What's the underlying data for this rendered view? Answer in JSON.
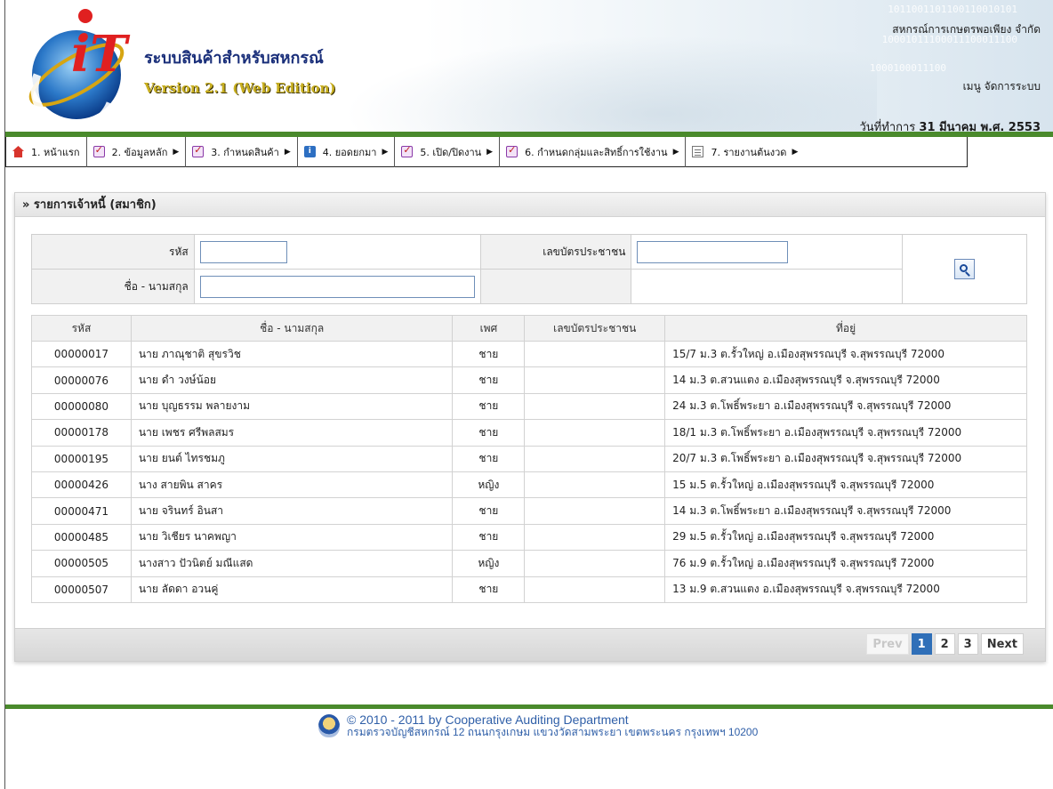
{
  "header": {
    "title": "ระบบสินค้าสำหรับสหกรณ์",
    "version": "Version 2.1 (Web Edition)",
    "org_name": "สหกรณ์การเกษตรพอเพียง จำกัด",
    "user_menu": "เมนู จัดการระบบ",
    "work_date_label": "วันที่ทำการ",
    "work_date_value": "31 มีนาคม พ.ศ. 2553",
    "logo_text": "iT",
    "logo_ring_text": "Full Pack Accounting Software · FAS",
    "binary_1": "1011001101100110010101",
    "binary_2": "10001011100011100011100",
    "binary_3": "1000100011100"
  },
  "menu": [
    {
      "label": "1. หน้าแรก",
      "icon": "home-icon",
      "arrow": false
    },
    {
      "label": "2. ข้อมูลหลัก",
      "icon": "checklist-icon",
      "arrow": true
    },
    {
      "label": "3. กำหนดสินค้า",
      "icon": "checklist-icon",
      "arrow": true
    },
    {
      "label": "4. ยอดยกมา",
      "icon": "info-icon",
      "arrow": true
    },
    {
      "label": "5. เปิด/ปิดงาน",
      "icon": "checklist-icon",
      "arrow": true
    },
    {
      "label": "6. กำหนดกลุ่มและสิทธิ์การใช้งาน",
      "icon": "checklist-icon",
      "arrow": true
    },
    {
      "label": "7. รายงานต้นงวด",
      "icon": "document-icon",
      "arrow": true
    }
  ],
  "panel": {
    "title": "» รายการเจ้าหนี้ (สมาชิก)"
  },
  "search": {
    "code_label": "รหัส",
    "code_value": "",
    "id_card_label": "เลขบัตรประชาชน",
    "id_card_value": "",
    "name_label": "ชื่อ - นามสกุล",
    "name_value": ""
  },
  "table": {
    "columns": [
      "รหัส",
      "ชื่อ - นามสกุล",
      "เพศ",
      "เลขบัตรประชาชน",
      "ที่อยู่"
    ],
    "rows": [
      {
        "code": "00000017",
        "name": "นาย ภาณุชาติ สุขรวิช",
        "sex": "ชาย",
        "id_card": "",
        "address": "15/7 ม.3 ต.รั้วใหญ่ อ.เมืองสุพรรณบุรี จ.สุพรรณบุรี 72000"
      },
      {
        "code": "00000076",
        "name": "นาย ดำ วงษ์น้อย",
        "sex": "ชาย",
        "id_card": "",
        "address": "14 ม.3 ต.สวนแตง อ.เมืองสุพรรณบุรี จ.สุพรรณบุรี 72000"
      },
      {
        "code": "00000080",
        "name": "นาย บุญธรรม พลายงาม",
        "sex": "ชาย",
        "id_card": "",
        "address": "24 ม.3 ต.โพธิ์พระยา อ.เมืองสุพรรณบุรี จ.สุพรรณบุรี 72000"
      },
      {
        "code": "00000178",
        "name": "นาย เพชร ศรีพลสมร",
        "sex": "ชาย",
        "id_card": "",
        "address": "18/1 ม.3 ต.โพธิ์พระยา อ.เมืองสุพรรณบุรี จ.สุพรรณบุรี 72000"
      },
      {
        "code": "00000195",
        "name": "นาย ยนต์ ไทรชมภู",
        "sex": "ชาย",
        "id_card": "",
        "address": "20/7 ม.3 ต.โพธิ์พระยา อ.เมืองสุพรรณบุรี จ.สุพรรณบุรี 72000"
      },
      {
        "code": "00000426",
        "name": "นาง สายพิน สาคร",
        "sex": "หญิง",
        "id_card": "",
        "address": "15 ม.5 ต.รั้วใหญ่ อ.เมืองสุพรรณบุรี จ.สุพรรณบุรี 72000"
      },
      {
        "code": "00000471",
        "name": "นาย จรินทร์ อินสา",
        "sex": "ชาย",
        "id_card": "",
        "address": "14 ม.3 ต.โพธิ์พระยา อ.เมืองสุพรรณบุรี จ.สุพรรณบุรี 72000"
      },
      {
        "code": "00000485",
        "name": "นาย วิเชียร นาคพญา",
        "sex": "ชาย",
        "id_card": "",
        "address": "29 ม.5 ต.รั้วใหญ่ อ.เมืองสุพรรณบุรี จ.สุพรรณบุรี 72000"
      },
      {
        "code": "00000505",
        "name": "นางสาว ปัวนิตย์ มณีแสด",
        "sex": "หญิง",
        "id_card": "",
        "address": "76 ม.9 ต.รั้วใหญ่ อ.เมืองสุพรรณบุรี จ.สุพรรณบุรี 72000"
      },
      {
        "code": "00000507",
        "name": "นาย ลัดดา อวนคู่",
        "sex": "ชาย",
        "id_card": "",
        "address": "13 ม.9 ต.สวนแตง อ.เมืองสุพรรณบุรี จ.สุพรรณบุรี 72000"
      }
    ]
  },
  "pager": {
    "prev": "Prev",
    "pages": [
      "1",
      "2",
      "3"
    ],
    "current": "1",
    "next": "Next"
  },
  "footer": {
    "copyright": "© 2010 - 2011  by Cooperative Auditing Department",
    "address": "กรมตรวจบัญชีสหกรณ์ 12 ถนนกรุงเกษม แขวงวัดสามพระยา เขตพระนคร กรุงเทพฯ 10200"
  },
  "colors": {
    "accent_green": "#4a8a2c",
    "title_blue": "#1a2f7a",
    "version_gold": "#c9b020",
    "pager_active": "#2f6fb8"
  }
}
